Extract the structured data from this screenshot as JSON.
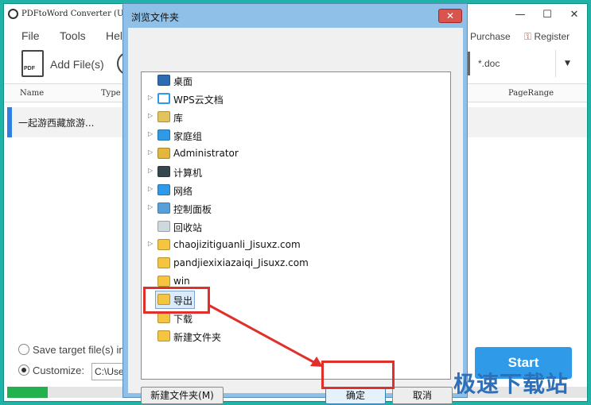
{
  "app": {
    "title": "PDFtoWord Converter (U",
    "menus": [
      "File",
      "Tools",
      "Help"
    ],
    "purchase": "Purchase",
    "register": "Register",
    "add_files": "Add File(s)",
    "pdf_icon_text": "PDF",
    "format_text": "*.doc",
    "columns": {
      "name": "Name",
      "type": "Type",
      "pagerange": "PageRange"
    },
    "file_row_name": "一起游西藏旅游...",
    "option_save_target": "Save target file(s) in",
    "option_customize": "Customize:",
    "path_value": "C:\\User",
    "start": "Start",
    "progress_pct": 7
  },
  "dialog": {
    "title": "浏览文件夹",
    "close_glyph": "✕",
    "items": [
      {
        "label": "桌面",
        "icon": "desktop-icon"
      },
      {
        "label": "WPS云文档",
        "icon": "cloud-icon"
      },
      {
        "label": "库",
        "icon": "library-icon"
      },
      {
        "label": "家庭组",
        "icon": "homegroup-icon"
      },
      {
        "label": "Administrator",
        "icon": "user-folder-icon"
      },
      {
        "label": "计算机",
        "icon": "computer-icon"
      },
      {
        "label": "网络",
        "icon": "network-icon"
      },
      {
        "label": "控制面板",
        "icon": "control-panel-icon"
      },
      {
        "label": "回收站",
        "icon": "recycle-bin-icon"
      },
      {
        "label": "chaojizitiguanli_Jisuxz.com",
        "icon": "folder-icon"
      },
      {
        "label": "pandjiexixiazaiqi_Jisuxz.com",
        "icon": "folder-icon"
      },
      {
        "label": "win",
        "icon": "folder-icon"
      },
      {
        "label": "导出",
        "icon": "folder-icon"
      },
      {
        "label": "下载",
        "icon": "folder-icon"
      },
      {
        "label": "新建文件夹",
        "icon": "folder-icon"
      }
    ],
    "new_folder_button": "新建文件夹(M)",
    "ok_button": "确定",
    "cancel_button": "取消"
  },
  "watermark": "极速下载站",
  "colors": {
    "accent": "#2f9ae8",
    "highlight": "#e0302b",
    "frame": "#1fb3a7",
    "progress": "#22b14c"
  }
}
